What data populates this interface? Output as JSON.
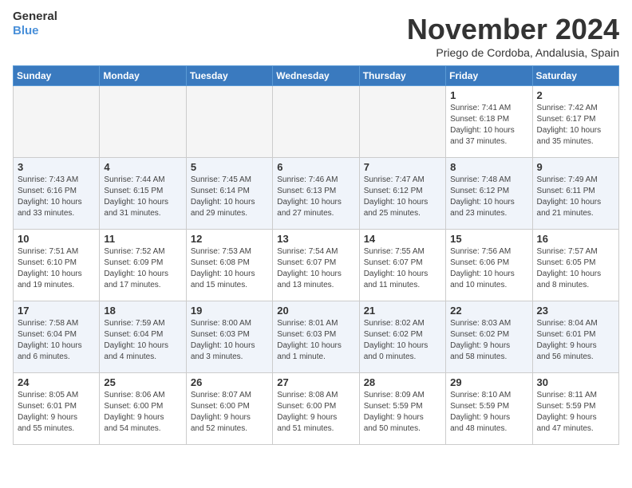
{
  "header": {
    "logo_line1": "General",
    "logo_line2": "Blue",
    "month": "November 2024",
    "location": "Priego de Cordoba, Andalusia, Spain"
  },
  "weekdays": [
    "Sunday",
    "Monday",
    "Tuesday",
    "Wednesday",
    "Thursday",
    "Friday",
    "Saturday"
  ],
  "rows": [
    [
      {
        "num": "",
        "info": "",
        "empty": true
      },
      {
        "num": "",
        "info": "",
        "empty": true
      },
      {
        "num": "",
        "info": "",
        "empty": true
      },
      {
        "num": "",
        "info": "",
        "empty": true
      },
      {
        "num": "",
        "info": "",
        "empty": true
      },
      {
        "num": "1",
        "info": "Sunrise: 7:41 AM\nSunset: 6:18 PM\nDaylight: 10 hours\nand 37 minutes.",
        "empty": false
      },
      {
        "num": "2",
        "info": "Sunrise: 7:42 AM\nSunset: 6:17 PM\nDaylight: 10 hours\nand 35 minutes.",
        "empty": false
      }
    ],
    [
      {
        "num": "3",
        "info": "Sunrise: 7:43 AM\nSunset: 6:16 PM\nDaylight: 10 hours\nand 33 minutes.",
        "empty": false
      },
      {
        "num": "4",
        "info": "Sunrise: 7:44 AM\nSunset: 6:15 PM\nDaylight: 10 hours\nand 31 minutes.",
        "empty": false
      },
      {
        "num": "5",
        "info": "Sunrise: 7:45 AM\nSunset: 6:14 PM\nDaylight: 10 hours\nand 29 minutes.",
        "empty": false
      },
      {
        "num": "6",
        "info": "Sunrise: 7:46 AM\nSunset: 6:13 PM\nDaylight: 10 hours\nand 27 minutes.",
        "empty": false
      },
      {
        "num": "7",
        "info": "Sunrise: 7:47 AM\nSunset: 6:12 PM\nDaylight: 10 hours\nand 25 minutes.",
        "empty": false
      },
      {
        "num": "8",
        "info": "Sunrise: 7:48 AM\nSunset: 6:12 PM\nDaylight: 10 hours\nand 23 minutes.",
        "empty": false
      },
      {
        "num": "9",
        "info": "Sunrise: 7:49 AM\nSunset: 6:11 PM\nDaylight: 10 hours\nand 21 minutes.",
        "empty": false
      }
    ],
    [
      {
        "num": "10",
        "info": "Sunrise: 7:51 AM\nSunset: 6:10 PM\nDaylight: 10 hours\nand 19 minutes.",
        "empty": false
      },
      {
        "num": "11",
        "info": "Sunrise: 7:52 AM\nSunset: 6:09 PM\nDaylight: 10 hours\nand 17 minutes.",
        "empty": false
      },
      {
        "num": "12",
        "info": "Sunrise: 7:53 AM\nSunset: 6:08 PM\nDaylight: 10 hours\nand 15 minutes.",
        "empty": false
      },
      {
        "num": "13",
        "info": "Sunrise: 7:54 AM\nSunset: 6:07 PM\nDaylight: 10 hours\nand 13 minutes.",
        "empty": false
      },
      {
        "num": "14",
        "info": "Sunrise: 7:55 AM\nSunset: 6:07 PM\nDaylight: 10 hours\nand 11 minutes.",
        "empty": false
      },
      {
        "num": "15",
        "info": "Sunrise: 7:56 AM\nSunset: 6:06 PM\nDaylight: 10 hours\nand 10 minutes.",
        "empty": false
      },
      {
        "num": "16",
        "info": "Sunrise: 7:57 AM\nSunset: 6:05 PM\nDaylight: 10 hours\nand 8 minutes.",
        "empty": false
      }
    ],
    [
      {
        "num": "17",
        "info": "Sunrise: 7:58 AM\nSunset: 6:04 PM\nDaylight: 10 hours\nand 6 minutes.",
        "empty": false
      },
      {
        "num": "18",
        "info": "Sunrise: 7:59 AM\nSunset: 6:04 PM\nDaylight: 10 hours\nand 4 minutes.",
        "empty": false
      },
      {
        "num": "19",
        "info": "Sunrise: 8:00 AM\nSunset: 6:03 PM\nDaylight: 10 hours\nand 3 minutes.",
        "empty": false
      },
      {
        "num": "20",
        "info": "Sunrise: 8:01 AM\nSunset: 6:03 PM\nDaylight: 10 hours\nand 1 minute.",
        "empty": false
      },
      {
        "num": "21",
        "info": "Sunrise: 8:02 AM\nSunset: 6:02 PM\nDaylight: 10 hours\nand 0 minutes.",
        "empty": false
      },
      {
        "num": "22",
        "info": "Sunrise: 8:03 AM\nSunset: 6:02 PM\nDaylight: 9 hours\nand 58 minutes.",
        "empty": false
      },
      {
        "num": "23",
        "info": "Sunrise: 8:04 AM\nSunset: 6:01 PM\nDaylight: 9 hours\nand 56 minutes.",
        "empty": false
      }
    ],
    [
      {
        "num": "24",
        "info": "Sunrise: 8:05 AM\nSunset: 6:01 PM\nDaylight: 9 hours\nand 55 minutes.",
        "empty": false
      },
      {
        "num": "25",
        "info": "Sunrise: 8:06 AM\nSunset: 6:00 PM\nDaylight: 9 hours\nand 54 minutes.",
        "empty": false
      },
      {
        "num": "26",
        "info": "Sunrise: 8:07 AM\nSunset: 6:00 PM\nDaylight: 9 hours\nand 52 minutes.",
        "empty": false
      },
      {
        "num": "27",
        "info": "Sunrise: 8:08 AM\nSunset: 6:00 PM\nDaylight: 9 hours\nand 51 minutes.",
        "empty": false
      },
      {
        "num": "28",
        "info": "Sunrise: 8:09 AM\nSunset: 5:59 PM\nDaylight: 9 hours\nand 50 minutes.",
        "empty": false
      },
      {
        "num": "29",
        "info": "Sunrise: 8:10 AM\nSunset: 5:59 PM\nDaylight: 9 hours\nand 48 minutes.",
        "empty": false
      },
      {
        "num": "30",
        "info": "Sunrise: 8:11 AM\nSunset: 5:59 PM\nDaylight: 9 hours\nand 47 minutes.",
        "empty": false
      }
    ]
  ],
  "alt_rows": [
    1,
    3
  ]
}
